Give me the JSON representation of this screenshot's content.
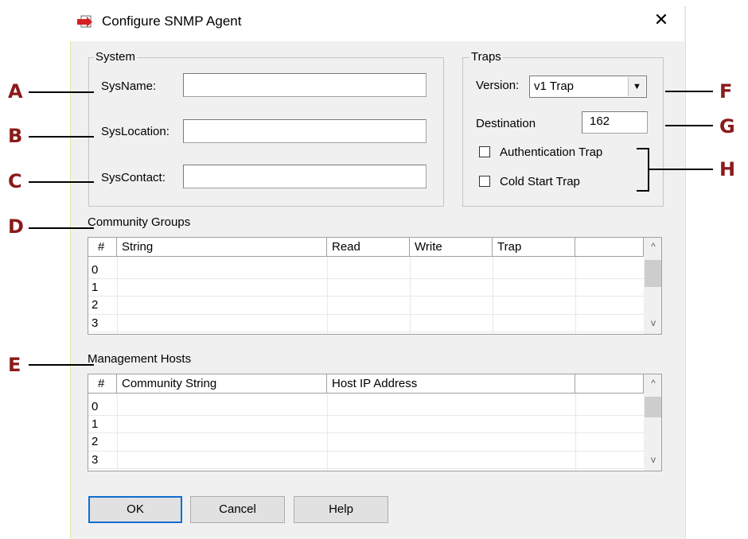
{
  "window": {
    "title": "Configure SNMP Agent",
    "close_glyph": "✕",
    "icon": "snmp-agent-icon"
  },
  "system": {
    "legend": "System",
    "sysname_label": "SysName:",
    "syslocation_label": "SysLocation:",
    "syscontact_label": "SysContact:",
    "sysname_value": "",
    "syslocation_value": "",
    "syscontact_value": ""
  },
  "traps": {
    "legend": "Traps",
    "version_label": "Version:",
    "version_value": "v1 Trap",
    "destination_label": "Destination",
    "destination_value": "162",
    "auth_trap_label": "Authentication Trap",
    "auth_trap_checked": false,
    "cold_start_label": "Cold Start Trap",
    "cold_start_checked": false
  },
  "community_groups": {
    "title": "Community Groups",
    "columns": [
      "#",
      "String",
      "Read",
      "Write",
      "Trap"
    ],
    "rows": [
      "0",
      "1",
      "2",
      "3"
    ]
  },
  "management_hosts": {
    "title": "Management Hosts",
    "columns": [
      "#",
      "Community String",
      "Host IP Address"
    ],
    "rows": [
      "0",
      "1",
      "2",
      "3"
    ]
  },
  "buttons": {
    "ok": "OK",
    "cancel": "Cancel",
    "help": "Help"
  },
  "scroll": {
    "up": "^",
    "down": "v"
  },
  "callouts": {
    "a": "A",
    "b": "B",
    "c": "C",
    "d": "D",
    "e": "E",
    "f": "F",
    "g": "G",
    "h": "H"
  },
  "colors": {
    "callout": "#8b1a1a",
    "default_button_border": "#0f6ed0",
    "dialog_bg": "#f0f0f0"
  }
}
